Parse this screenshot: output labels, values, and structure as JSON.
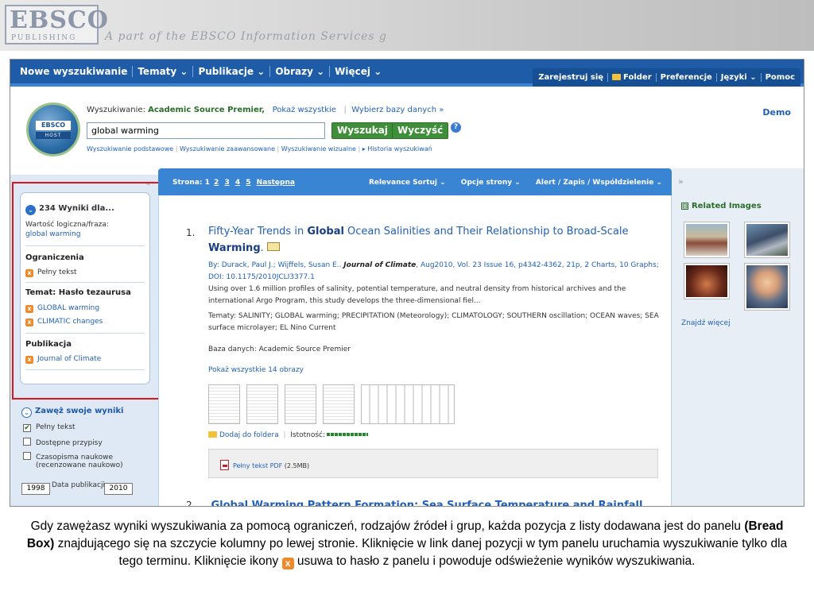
{
  "banner": {
    "logo_main": "EBSCO",
    "logo_sub": "PUBLISHING",
    "tagline": "A part of the EBSCO Information Services g"
  },
  "nav": {
    "left": [
      "Nowe wyszukiwanie",
      "Tematy ⌄",
      "Publikacje ⌄",
      "Obrazy ⌄",
      "Więcej ⌄"
    ],
    "right": {
      "register": "Zarejestruj się",
      "folder": "Folder",
      "prefs": "Preferencje",
      "lang": "Języki ⌄",
      "help": "Pomoc"
    }
  },
  "search": {
    "logo_top": "EBSCO",
    "logo_bottom": "HOST",
    "label": "Wyszukiwanie:",
    "db": "Academic Source Premier,",
    "show_all": "Pokaż wszystkie",
    "choose_db": "Wybierz bazy danych »",
    "query": "global warming",
    "btn_search": "Wyszukaj",
    "btn_clear": "Wyczyść",
    "help_icon": "?",
    "links": [
      "Wyszukiwanie podstawowe",
      "Wyszukiwanie zaawansowane",
      "Wyszukiwanie wizualne",
      "▸ Historia wyszukiwań"
    ],
    "demo": "Demo"
  },
  "left": {
    "collapse": "«",
    "bread": {
      "heading": "234 Wyniki dla...",
      "heading_icon": "⌄",
      "bool_label": "Wartość logiczna/fraza:",
      "bool_value": "global warming",
      "limits": "Ograniczenia",
      "limit1": "Pełny tekst",
      "subject": "Temat: Hasło tezaurusa",
      "subj1": "GLOBAL warming",
      "subj2": "CLIMATIC changes",
      "pub": "Publikacja",
      "pub1": "Journal of Climate",
      "remove_icon": "x"
    },
    "narrow": {
      "title": "Zawęż swoje wyniki",
      "title_icon": "⌄",
      "cb1": "Pełny tekst",
      "cb1_mark": "✔",
      "cb2": "Dostępne przypisy",
      "cb3a": "Czasopisma naukowe",
      "cb3b": "(recenzowane naukowo)",
      "year_from": "1998",
      "year_label": "Data publikacji",
      "year_to": "2010"
    }
  },
  "results": {
    "pages_label": "Strona:",
    "pages": [
      "1",
      "2",
      "3",
      "4",
      "5"
    ],
    "next": "Następna",
    "sort": "Relevance Sortuj ⌄",
    "options": "Opcje strony ⌄",
    "alert": "Alert / Zapis / Współdzielenie ⌄",
    "r1": {
      "num": "1.",
      "title_a": "Fifty-Year Trends in ",
      "title_b": "Global",
      "title_c": " Ocean Salinities and Their Relationship to Broad-Scale ",
      "title_d": "Warming",
      "by_a": "By: Durack, Paul J.; Wijffels, Susan E.. ",
      "journal": "Journal of Climate",
      "by_b": ", Aug2010, Vol. 23 Issue 16, p4342-4362, 21p, 2 Charts, 10 Graphs; DOI: 10.1175/2010JCLI3377.1",
      "abstract": "Using over 1.6 million profiles of salinity, potential temperature, and neutral density from historical archives and the international Argo Program, this study develops the three-dimensional fiel...",
      "subjects": "Tematy: SALINITY; GLOBAL warming; PRECIPITATION (Meteorology); CLIMATOLOGY; SOUTHERN oscillation; OCEAN waves; SEA surface microlayer; EL Nino Current",
      "database": "Baza danych: Academic Source Premier",
      "images": "Pokaż wszystkie 14 obrazy",
      "add_folder": "Dodaj do foldera",
      "relevance": "Istotność:",
      "pdf": "Pełny tekst PDF",
      "pdf_size": " (2.5MB)"
    },
    "r2": {
      "num": "2.",
      "title": "Global Warming Pattern Formation: Sea Surface Temperature and Rainfall"
    }
  },
  "right": {
    "expand": "»",
    "heading": "Related Images",
    "heading_icon": "⊟",
    "more": "Znajdź więcej"
  },
  "caption": {
    "p1": "Gdy zawężasz wyniki wyszukiwania za pomocą ograniczeń, rodzajów źródeł i grup, każda pozycja z listy dodawana jest do panelu ",
    "bold": "(Bread Box)",
    "p2": " znajdującego się na szczycie kolumny po lewej stronie. Kliknięcie w link danej pozycji w tym panelu uruchamia wyszukiwanie tylko dla tego terminu. Kliknięcie ikony ",
    "icon": "x",
    "p3": " usuwa to hasło z panelu i powoduje odświeżenie wyników wyszukiwania."
  }
}
